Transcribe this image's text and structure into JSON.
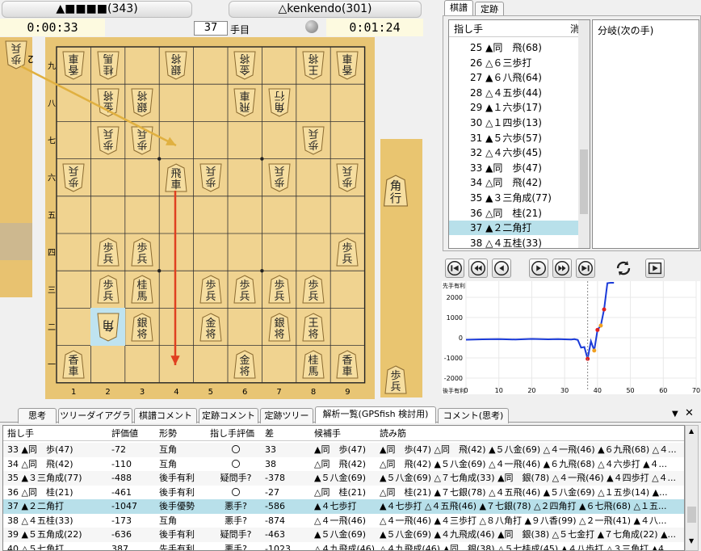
{
  "header": {
    "black_player": "▲■■■■(343)",
    "white_player": "△kenkendo(301)",
    "black_time": "0:00:33",
    "white_time": "0:01:24",
    "move_number": "37",
    "move_suffix": "手目"
  },
  "board": {
    "file_labels": [
      "1",
      "2",
      "3",
      "4",
      "5",
      "6",
      "7",
      "8",
      "9"
    ],
    "rank_labels": [
      "九",
      "八",
      "七",
      "六",
      "五",
      "四",
      "三",
      "二",
      "一"
    ],
    "white_pieces": [
      {
        "label": "香車",
        "sq": [
          0,
          0
        ]
      },
      {
        "label": "桂馬",
        "sq": [
          1,
          0
        ]
      },
      {
        "label": "銀将",
        "sq": [
          3,
          0
        ]
      },
      {
        "label": "金将",
        "sq": [
          5,
          0
        ]
      },
      {
        "label": "王将",
        "sq": [
          7,
          0
        ]
      },
      {
        "label": "香車",
        "sq": [
          8,
          0
        ]
      },
      {
        "label": "金将",
        "sq": [
          1,
          1
        ]
      },
      {
        "label": "銀将",
        "sq": [
          2,
          1
        ]
      },
      {
        "label": "飛車",
        "sq": [
          5,
          1
        ]
      },
      {
        "label": "角行",
        "sq": [
          6,
          1
        ]
      },
      {
        "label": "歩兵",
        "sq": [
          1,
          2
        ]
      },
      {
        "label": "歩兵",
        "sq": [
          2,
          2
        ]
      },
      {
        "label": "歩兵",
        "sq": [
          7,
          2
        ]
      },
      {
        "label": "歩兵",
        "sq": [
          0,
          3
        ]
      },
      {
        "label": "歩兵",
        "sq": [
          4,
          3
        ]
      },
      {
        "label": "歩兵",
        "sq": [
          6,
          3
        ]
      },
      {
        "label": "歩兵",
        "sq": [
          8,
          3
        ]
      }
    ],
    "black_pieces": [
      {
        "label": "飛車",
        "sq": [
          3,
          3
        ]
      },
      {
        "label": "歩兵",
        "sq": [
          1,
          5
        ]
      },
      {
        "label": "歩兵",
        "sq": [
          2,
          5
        ]
      },
      {
        "label": "歩兵",
        "sq": [
          8,
          5
        ]
      },
      {
        "label": "歩兵",
        "sq": [
          1,
          6
        ]
      },
      {
        "label": "桂馬",
        "sq": [
          2,
          6
        ]
      },
      {
        "label": "歩兵",
        "sq": [
          4,
          6
        ]
      },
      {
        "label": "歩兵",
        "sq": [
          5,
          6
        ]
      },
      {
        "label": "歩兵",
        "sq": [
          6,
          6
        ]
      },
      {
        "label": "歩兵",
        "sq": [
          7,
          6
        ]
      },
      {
        "label": "銀将",
        "sq": [
          2,
          7
        ]
      },
      {
        "label": "金将",
        "sq": [
          4,
          7
        ]
      },
      {
        "label": "銀将",
        "sq": [
          6,
          7
        ]
      },
      {
        "label": "王将",
        "sq": [
          7,
          7
        ]
      },
      {
        "label": "香車",
        "sq": [
          0,
          8
        ]
      },
      {
        "label": "金将",
        "sq": [
          5,
          8
        ]
      },
      {
        "label": "桂馬",
        "sq": [
          7,
          8
        ]
      },
      {
        "label": "香車",
        "sq": [
          8,
          8
        ]
      }
    ],
    "highlight_piece": {
      "label": "角",
      "sq": [
        1,
        7
      ]
    },
    "white_hand": [
      {
        "label": "歩兵",
        "count": "2"
      }
    ],
    "black_hand": [
      {
        "label": "角行"
      },
      {
        "label": "歩兵"
      }
    ]
  },
  "kifu": {
    "tabs": [
      "棋譜",
      "定跡"
    ],
    "header": "指し手",
    "header2": "消",
    "items": [
      "25 ▲同　飛(68)",
      "26 △６三歩打",
      "27 ▲６八飛(64)",
      "28 △４五歩(44)",
      "29 ▲１六歩(17)",
      "30 △１四歩(13)",
      "31 ▲５六歩(57)",
      "32 △４六歩(45)",
      "33 ▲同　歩(47)",
      "34 △同　飛(42)",
      "35 ▲３三角成(77)",
      "36 △同　桂(21)",
      "37 ▲２二角打",
      "38 △４五桂(33)"
    ],
    "selected_index": 12,
    "branch_header": "分岐(次の手)"
  },
  "graph": {
    "top_label": "先手有利",
    "bottom_label": "後手有利",
    "y_ticks": [
      "2000",
      "1000",
      "0",
      "-1000",
      "-2000"
    ],
    "x_ticks": [
      "0",
      "10",
      "20",
      "30",
      "40",
      "50",
      "60",
      "70"
    ]
  },
  "bottom_tabs": [
    "思考",
    "ツリーダイアグラム",
    "棋譜コメント",
    "定跡コメント",
    "定跡ツリー",
    "解析一覧(GPSfish 検討用)",
    "コメント(思考)"
  ],
  "analysis": {
    "columns": [
      "指し手",
      "評価値",
      "形勢",
      "指し手評価",
      "差",
      "候補手",
      "読み筋"
    ],
    "rows": [
      [
        "33 ▲同　歩(47)",
        "-72",
        "互角",
        "〇",
        "33",
        "▲同　歩(47)",
        "▲同　歩(47) △同　飛(42) ▲５八金(69) △４一飛(46) ▲６九飛(68) △４..."
      ],
      [
        "34 △同　飛(42)",
        "-110",
        "互角",
        "〇",
        "38",
        "△同　飛(42)",
        "△同　飛(42) ▲５八金(69) △４一飛(46) ▲６九飛(68) △４六歩打 ▲４..."
      ],
      [
        "35 ▲３三角成(77)",
        "-488",
        "後手有利",
        "疑問手?",
        "-378",
        "▲５八金(69)",
        "▲５八金(69) △７七角成(33) ▲同　銀(78) △４一飛(46) ▲４四歩打 △４..."
      ],
      [
        "36 △同　桂(21)",
        "-461",
        "後手有利",
        "〇",
        "-27",
        "△同　桂(21)",
        "△同　桂(21) ▲７七銀(78) △４五飛(46) ▲５八金(69) △１五歩(14) ▲..."
      ],
      [
        "37 ▲２二角打",
        "-1047",
        "後手優勢",
        "悪手?",
        "-586",
        "▲４七歩打",
        "▲４七歩打 △４五飛(46) ▲７七銀(78) △２四角打 ▲６七飛(68) △１五..."
      ],
      [
        "38 △４五桂(33)",
        "-173",
        "互角",
        "悪手?",
        "-874",
        "△４一飛(46)",
        "△４一飛(46) ▲４三歩打 △８八角打 ▲９八香(99) △２一飛(41) ▲４八..."
      ],
      [
        "39 ▲５五角成(22)",
        "-636",
        "後手有利",
        "疑問手?",
        "-463",
        "▲５八金(69)",
        "▲５八金(69) ▲４九飛成(46) ▲同　銀(38) △５七金打 ▲７七角成(22) ▲..."
      ],
      [
        "40 △５七角打",
        "387",
        "先手有利",
        "悪手?",
        "-1023",
        "△４九飛成(46)",
        "△４九飛成(46) ▲同　銀(38) △５七桂成(45) ▲４八歩打 △３三角打 ▲4..."
      ]
    ],
    "selected_index": 4
  }
}
